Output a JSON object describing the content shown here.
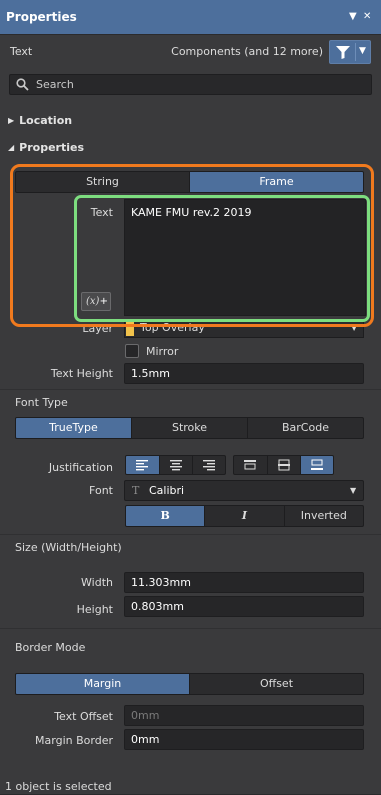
{
  "panel": {
    "title": "Properties",
    "pin_icon": "pin-icon",
    "close_icon": "close-icon"
  },
  "header": {
    "object_type": "Text",
    "filter_text": "Components (and 12 more)",
    "filter_icon": "funnel-icon"
  },
  "search": {
    "placeholder": "Search"
  },
  "sections": {
    "location": "Location",
    "properties": "Properties"
  },
  "text_mode": {
    "options": [
      "String",
      "Frame"
    ],
    "selected": "Frame"
  },
  "text_field": {
    "label": "Text",
    "value": "KAME FMU rev.2 2019",
    "fx_label": "(x)",
    "fx_plus": "+"
  },
  "layer": {
    "label": "Layer",
    "value": "Top Overlay",
    "swatch_color": "#f1c24b"
  },
  "mirror": {
    "label": "Mirror",
    "checked": false
  },
  "text_height": {
    "label": "Text Height",
    "value": "1.5mm"
  },
  "font_type": {
    "heading": "Font Type",
    "options": [
      "TrueType",
      "Stroke",
      "BarCode"
    ],
    "selected": "TrueType"
  },
  "justification": {
    "label": "Justification",
    "horizontal": [
      "align-left-icon",
      "align-center-icon",
      "align-right-icon"
    ],
    "vertical": [
      "align-top-icon",
      "align-middle-icon",
      "align-bottom-icon"
    ],
    "selected_vertical": "align-bottom-icon"
  },
  "font": {
    "label": "Font",
    "value": "Calibri",
    "glyph": "T",
    "styles": [
      "B",
      "I",
      "Inverted"
    ],
    "selected_style": "B"
  },
  "size": {
    "heading": "Size (Width/Height)",
    "width_label": "Width",
    "width_value": "11.303mm",
    "height_label": "Height",
    "height_value": "0.803mm"
  },
  "border_mode": {
    "heading": "Border Mode",
    "options": [
      "Margin",
      "Offset"
    ],
    "selected": "Margin",
    "text_offset_label": "Text Offset",
    "text_offset_value": "0mm",
    "margin_border_label": "Margin Border",
    "margin_border_value": "0mm"
  },
  "annotations": {
    "outer_highlight_color": "#f07a1e",
    "inner_highlight_color": "#7ddd7f"
  },
  "status": {
    "text": "1 object is selected"
  },
  "colors": {
    "accent": "#4d6f9c",
    "panel_bg": "#3a3a3c"
  }
}
